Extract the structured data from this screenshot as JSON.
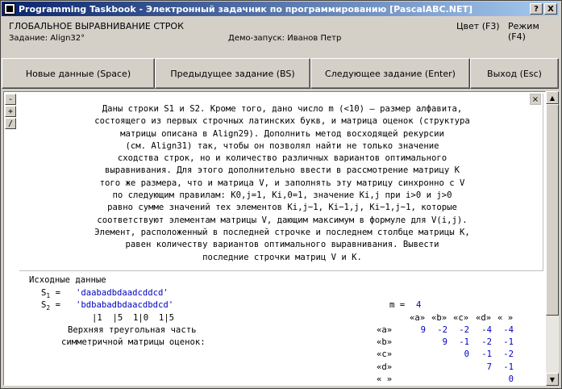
{
  "window": {
    "title": "Programming Taskbook - Электронный задачник по программированию [PascalABC.NET]",
    "help_btn": "?",
    "close_btn": "X"
  },
  "info": {
    "topic": "ГЛОБАЛЬНОЕ ВЫРАВНИВАНИЕ СТРОК",
    "task": "Задание: Align32°",
    "demo": "Демо-запуск: Иванов Петр",
    "color": "Цвет (F3)",
    "mode": "Режим (F4)"
  },
  "buttons": {
    "new_data": "Новые данные (Space)",
    "prev": "Предыдущее задание (BS)",
    "next": "Следующее задание (Enter)",
    "exit": "Выход (Esc)"
  },
  "side": {
    "minus": "-",
    "plus": "+",
    "slash": "/",
    "close": "×"
  },
  "task_lines": [
    "Даны строки S1 и S2. Кроме того, дано число m (<10) — размер алфавита,",
    "состоящего из первых строчных латинских букв, и матрица оценок (структура",
    "матрицы описана в Align29). Дополнить метод восходящей рекурсии",
    "(см. Align31) так, чтобы он позволял найти не только значение",
    "сходства строк, но и количество различных вариантов оптимального",
    "выравнивания. Для этого дополнительно ввести в рассмотрение матрицу K",
    "того же размера, что и матрица V, и заполнять эту матрицу синхронно с V",
    "по следующим правилам: K0,j=1, Ki,0=1, значение Ki,j при i>0 и j>0",
    "равно сумме значений тех элементов Ki,j−1, Ki−1,j, Ki−1,j−1, которые",
    "соответствуют элементам матрицы V, дающим максимум в формуле для V(i,j).",
    "Элемент, расположенный в последней строчке и последнем столбце матрицы K,",
    "равен количеству вариантов оптимального выравнивания. Вывести",
    "последние строчки матриц V и K."
  ],
  "input": {
    "header": "Исходные данные",
    "s1_label": "S1 = ",
    "s1_value": "'daabadbdaadcddcd'",
    "s2_label": "S2 = ",
    "s2_value": "'bdbabadbdaacdbdcd'",
    "hint": "|1  |5  1|0  1|5",
    "m_label": "m = ",
    "m_value": "4",
    "matrix_caption_1": "Верхняя треугольная часть",
    "matrix_caption_2": "симметричной матрицы оценок:",
    "matrix_cols": [
      "«a»",
      "«b»",
      "«c»",
      "«d»",
      "« »"
    ],
    "matrix_rows": [
      {
        "label": "«a»",
        "values": [
          "9",
          "-2",
          "-2",
          "-4",
          "-4"
        ]
      },
      {
        "label": "«b»",
        "values": [
          "",
          "9",
          "-1",
          "-2",
          "-1"
        ]
      },
      {
        "label": "«c»",
        "values": [
          "",
          "",
          "0",
          "-1",
          "-2"
        ]
      },
      {
        "label": "«d»",
        "values": [
          "",
          "",
          "",
          "7",
          "-1"
        ]
      },
      {
        "label": "« »",
        "values": [
          "",
          "",
          "",
          "",
          "0"
        ]
      }
    ]
  },
  "colors": {
    "title_start": "#0a246a",
    "title_end": "#a6caf0",
    "data_blue": "#0000c0"
  }
}
